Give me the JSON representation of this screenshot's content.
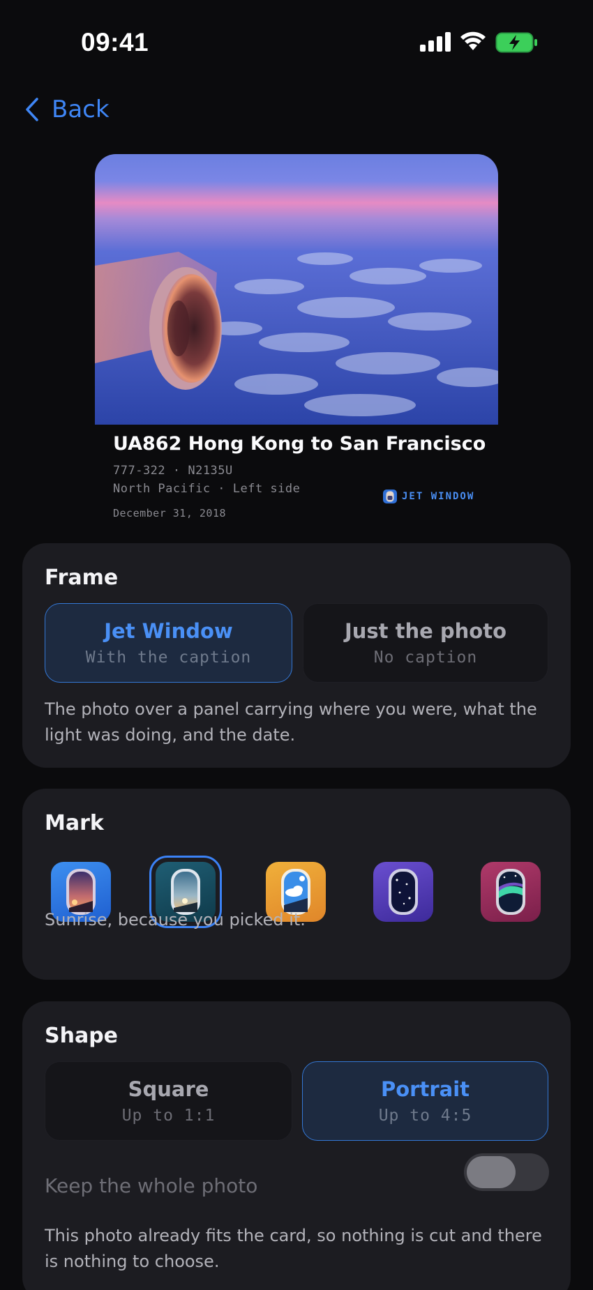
{
  "status_bar": {
    "time": "09:41"
  },
  "nav": {
    "back_label": "Back"
  },
  "preview": {
    "title": "UA862 Hong Kong to San Francisco",
    "line1": "777-322 · N2135U",
    "line2": "North Pacific · Left side",
    "date": "December 31, 2018",
    "brand": "JET WINDOW"
  },
  "frame": {
    "title": "Frame",
    "options": [
      {
        "label": "Jet Window",
        "sub": "With the caption",
        "selected": true
      },
      {
        "label": "Just the photo",
        "sub": "No caption",
        "selected": false
      }
    ],
    "description": "The photo over a panel carrying where you were, what the light was doing, and the date."
  },
  "mark": {
    "title": "Mark",
    "icons": [
      {
        "name": "dusk-window-icon",
        "selected": false
      },
      {
        "name": "sunrise-window-icon",
        "selected": true
      },
      {
        "name": "day-cloud-window-icon",
        "selected": false
      },
      {
        "name": "night-stars-window-icon",
        "selected": false
      },
      {
        "name": "aurora-window-icon",
        "selected": false
      }
    ],
    "description": "Sunrise, because you picked it."
  },
  "shape": {
    "title": "Shape",
    "options": [
      {
        "label": "Square",
        "sub": "Up to 1:1",
        "selected": false
      },
      {
        "label": "Portrait",
        "sub": "Up to 4:5",
        "selected": true
      }
    ],
    "toggle_label": "Keep the whole photo",
    "toggle_on": false,
    "description": "This photo already fits the card, so nothing is cut and there is nothing to choose."
  },
  "colors": {
    "accent": "#3f86f5",
    "panel": "#1c1c21",
    "background": "#0b0b0d"
  }
}
